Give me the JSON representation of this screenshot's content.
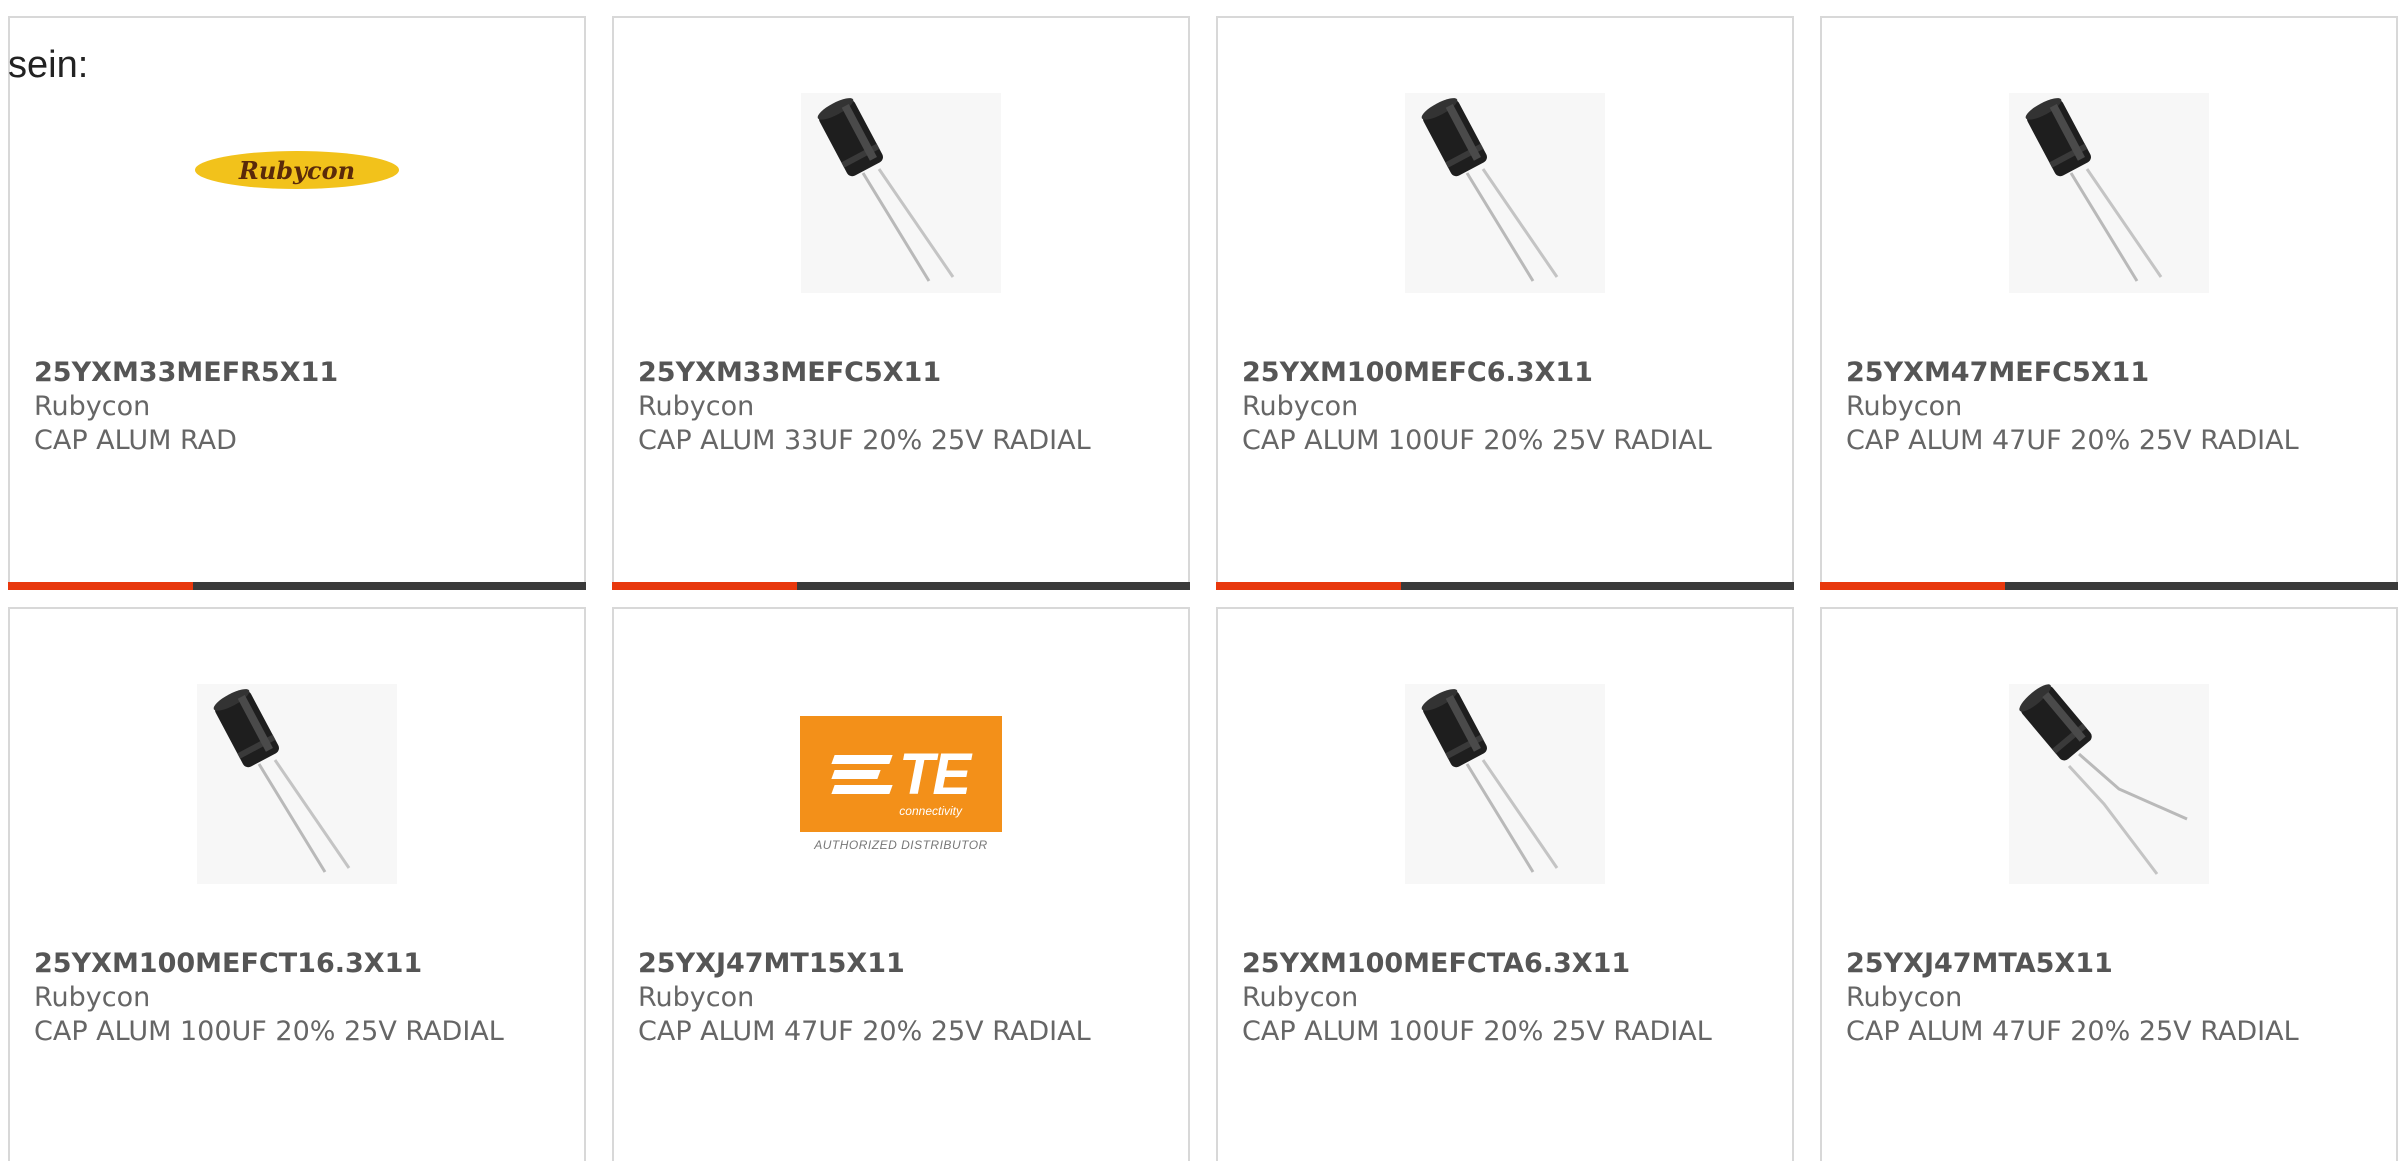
{
  "intro_text": "sein:",
  "accent_color": "#e8380d",
  "products": [
    {
      "part_number": "25YXM33MEFR5X11",
      "manufacturer": "Rubycon",
      "description": "CAP ALUM RAD",
      "image": "rubycon-logo",
      "logo_text": "Rubycon",
      "progress": 0.32
    },
    {
      "part_number": "25YXM33MEFC5X11",
      "manufacturer": "Rubycon",
      "description": "CAP ALUM 33UF 20% 25V RADIAL",
      "image": "capacitor-photo",
      "progress": 0.32
    },
    {
      "part_number": "25YXM100MEFC6.3X11",
      "manufacturer": "Rubycon",
      "description": "CAP ALUM 100UF 20% 25V RADIAL",
      "image": "capacitor-photo",
      "progress": 0.32
    },
    {
      "part_number": "25YXM47MEFC5X11",
      "manufacturer": "Rubycon",
      "description": "CAP ALUM 47UF 20% 25V RADIAL",
      "image": "capacitor-photo",
      "progress": 0.32
    },
    {
      "part_number": "25YXM100MEFCT16.3X11",
      "manufacturer": "Rubycon",
      "description": "CAP ALUM 100UF 20% 25V RADIAL",
      "image": "capacitor-photo"
    },
    {
      "part_number": "25YXJ47MT15X11",
      "manufacturer": "Rubycon",
      "description": "CAP ALUM 47UF 20% 25V RADIAL",
      "image": "te-connectivity-logo",
      "logo_text": "TE",
      "logo_sub": "connectivity",
      "logo_caption": "AUTHORIZED DISTRIBUTOR"
    },
    {
      "part_number": "25YXM100MEFCTA6.3X11",
      "manufacturer": "Rubycon",
      "description": "CAP ALUM 100UF 20% 25V RADIAL",
      "image": "capacitor-photo"
    },
    {
      "part_number": "25YXJ47MTA5X11",
      "manufacturer": "Rubycon",
      "description": "CAP ALUM 47UF 20% 25V RADIAL",
      "image": "capacitor-photo-bent"
    }
  ]
}
